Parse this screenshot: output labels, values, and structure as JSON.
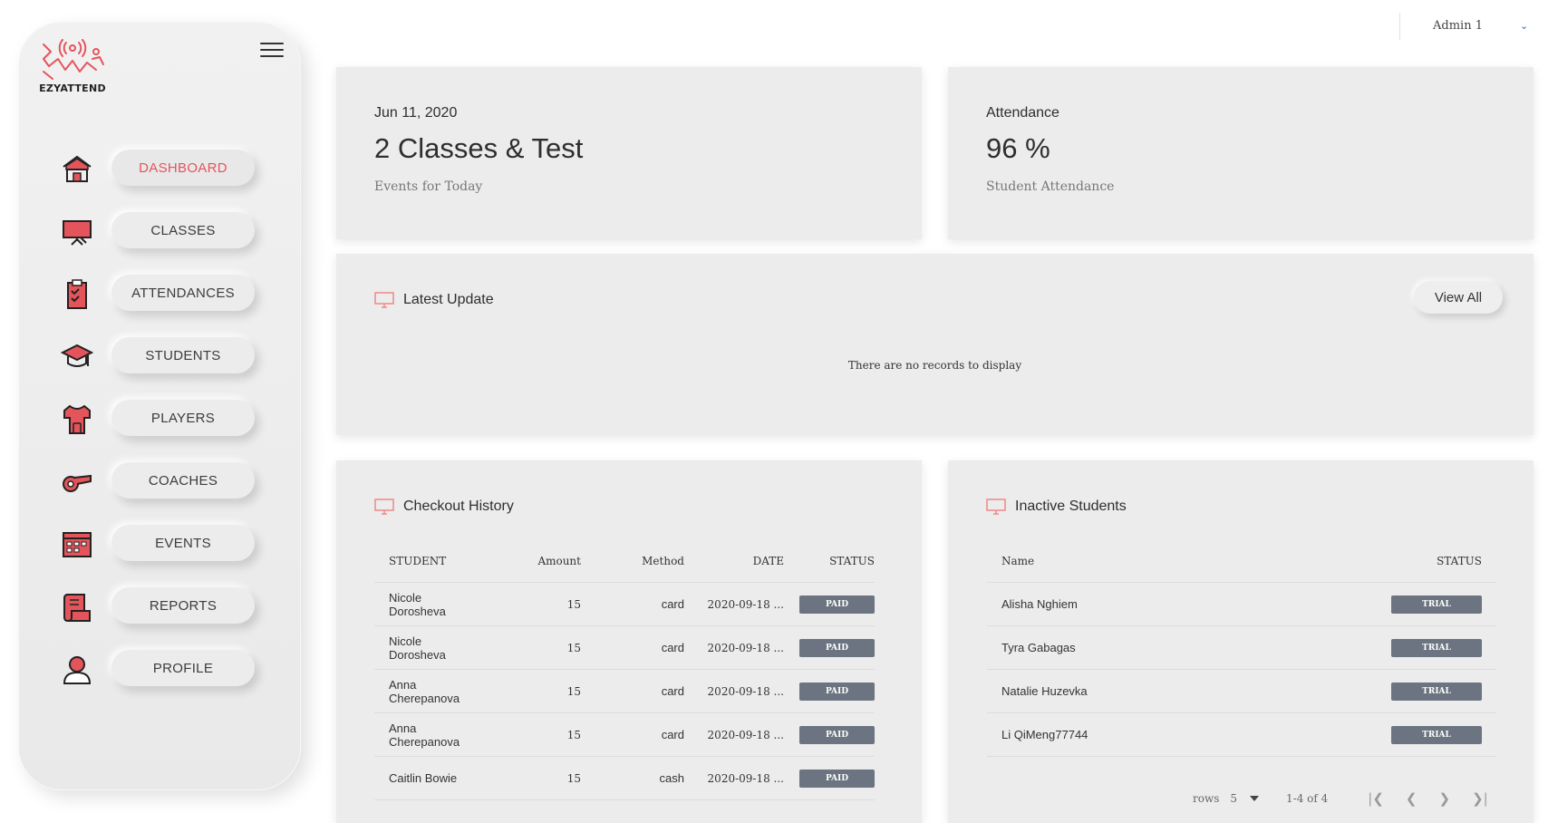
{
  "brand": {
    "logo_text": "EZYATTEND",
    "accent": "#e4545b"
  },
  "user": {
    "name": "Admin 1"
  },
  "nav": [
    {
      "label": "DASHBOARD",
      "icon": "house-icon",
      "active": true
    },
    {
      "label": "CLASSES",
      "icon": "whiteboard-icon"
    },
    {
      "label": "ATTENDANCES",
      "icon": "clipboard-check-icon"
    },
    {
      "label": "STUDENTS",
      "icon": "graduation-cap-icon"
    },
    {
      "label": "PLAYERS",
      "icon": "jersey-icon"
    },
    {
      "label": "COACHES",
      "icon": "whistle-icon"
    },
    {
      "label": "EVENTS",
      "icon": "calendar-board-icon"
    },
    {
      "label": "REPORTS",
      "icon": "scroll-icon"
    },
    {
      "label": "PROFILE",
      "icon": "user-icon"
    }
  ],
  "events_card": {
    "date": "Jun 11, 2020",
    "value": "2 Classes & Test",
    "sub": "Events for Today"
  },
  "attendance_card": {
    "label": "Attendance",
    "value": "96 %",
    "sub": "Student Attendance"
  },
  "latest_update": {
    "title": "Latest Update",
    "view_all": "View All",
    "empty": "There are no records to display"
  },
  "checkout": {
    "title": "Checkout History",
    "columns": [
      "STUDENT",
      "Amount",
      "Method",
      "DATE",
      "STATUS"
    ],
    "rows": [
      {
        "student_first": "Nicole",
        "student_last": "Dorosheva",
        "amount": "15",
        "method": "card",
        "date": "2020-09-18 ...",
        "status": "PAID"
      },
      {
        "student_first": "Nicole",
        "student_last": "Dorosheva",
        "amount": "15",
        "method": "card",
        "date": "2020-09-18 ...",
        "status": "PAID"
      },
      {
        "student_first": "Anna",
        "student_last": "Cherepanova",
        "amount": "15",
        "method": "card",
        "date": "2020-09-18 ...",
        "status": "PAID"
      },
      {
        "student_first": "Anna",
        "student_last": "Cherepanova",
        "amount": "15",
        "method": "card",
        "date": "2020-09-18 ...",
        "status": "PAID"
      },
      {
        "student_first": "Caitlin Bowie",
        "student_last": "",
        "amount": "15",
        "method": "cash",
        "date": "2020-09-18 ...",
        "status": "PAID"
      }
    ]
  },
  "inactive": {
    "title": "Inactive Students",
    "columns": [
      "Name",
      "STATUS"
    ],
    "rows": [
      {
        "name": "Alisha Nghiem",
        "status": "TRIAL"
      },
      {
        "name": "Tyra Gabagas",
        "status": "TRIAL"
      },
      {
        "name": "Natalie Huzevka",
        "status": "TRIAL"
      },
      {
        "name": "Li QiMeng77744",
        "status": "TRIAL"
      }
    ],
    "pager": {
      "rows_label": "rows",
      "rows_value": "5",
      "range": "1-4 of 4"
    }
  }
}
